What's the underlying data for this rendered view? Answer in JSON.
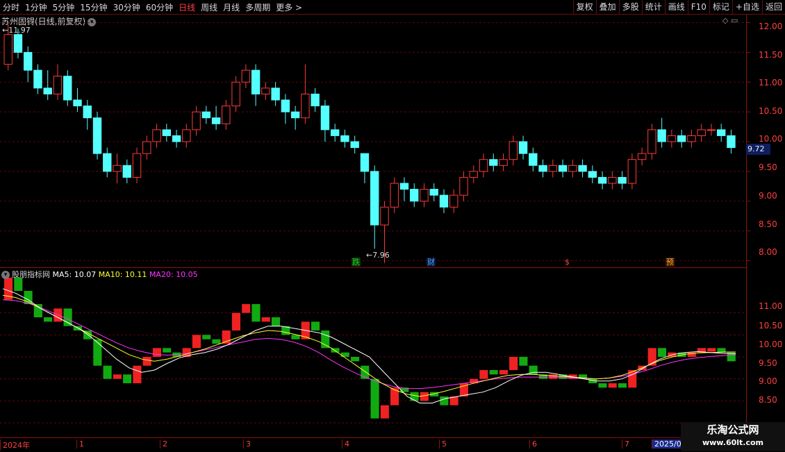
{
  "toolbar": {
    "periods": [
      "分时",
      "1分钟",
      "5分钟",
      "15分钟",
      "30分钟",
      "60分钟",
      "日线",
      "周线",
      "月线",
      "多周期",
      "更多 >"
    ],
    "active_period": "日线",
    "actions": [
      "复权",
      "叠加",
      "多股",
      "统计",
      "画线",
      "F10",
      "标记",
      "+自选",
      "返回"
    ]
  },
  "main_chart": {
    "title": "苏州固锝(日线,前复权)",
    "high_label": "11.97",
    "low_label": "7.96",
    "current_price": "9.72",
    "price_ticks": [
      "12.00",
      "11.50",
      "11.00",
      "10.50",
      "10.00",
      "9.50",
      "9.00",
      "8.50",
      "8.00"
    ],
    "tags": [
      {
        "text": "跌",
        "color": "#22cc22",
        "bg": "#0a3a0a"
      },
      {
        "text": "财",
        "color": "#4aa0ff",
        "bg": "#0a1a3a"
      },
      {
        "text": "$",
        "color": "#ff4040",
        "bg": "#000"
      },
      {
        "text": "预",
        "color": "#ffaa33",
        "bg": "#3a1a00"
      }
    ]
  },
  "indicator": {
    "name": "股朋指标网",
    "ma5": "MA5: 10.07",
    "ma10": "MA10: 10.11",
    "ma20": "MA20: 10.05",
    "ticks": [
      "11.00",
      "10.50",
      "10.00",
      "9.50",
      "9.00",
      "8.50"
    ]
  },
  "time_axis": [
    "2024年",
    "1",
    "2",
    "3",
    "4",
    "5",
    "6",
    "7",
    "2025/0"
  ],
  "watermark": {
    "line1": "乐淘公式网",
    "line2": "www.60lt.com"
  },
  "colors": {
    "up": "#ff3a3a",
    "down": "#54ffff",
    "grid": "#5a0a0a",
    "ma5": "#ffffff",
    "ma10": "#ffff33",
    "ma20": "#ff33ff"
  },
  "chart_data": {
    "type": "candlestick",
    "ylim": [
      7.9,
      12.1
    ],
    "candles": [
      [
        11.3,
        11.8,
        11.2,
        11.97
      ],
      [
        11.8,
        11.5,
        11.4,
        11.9
      ],
      [
        11.5,
        11.2,
        11.0,
        11.6
      ],
      [
        11.2,
        10.9,
        10.8,
        11.3
      ],
      [
        10.9,
        10.8,
        10.7,
        11.2
      ],
      [
        10.8,
        11.1,
        10.7,
        11.3
      ],
      [
        11.1,
        10.7,
        10.6,
        11.2
      ],
      [
        10.7,
        10.6,
        10.5,
        10.9
      ],
      [
        10.6,
        10.4,
        10.2,
        10.7
      ],
      [
        10.4,
        9.8,
        9.7,
        10.5
      ],
      [
        9.8,
        9.5,
        9.4,
        9.9
      ],
      [
        9.5,
        9.6,
        9.3,
        9.8
      ],
      [
        9.6,
        9.4,
        9.3,
        9.7
      ],
      [
        9.4,
        9.8,
        9.3,
        9.9
      ],
      [
        9.8,
        10.0,
        9.7,
        10.1
      ],
      [
        10.0,
        10.2,
        9.9,
        10.3
      ],
      [
        10.2,
        10.1,
        10.0,
        10.3
      ],
      [
        10.1,
        10.0,
        9.9,
        10.2
      ],
      [
        10.0,
        10.2,
        9.9,
        10.3
      ],
      [
        10.2,
        10.5,
        10.1,
        10.6
      ],
      [
        10.5,
        10.4,
        10.3,
        10.6
      ],
      [
        10.4,
        10.3,
        10.2,
        10.6
      ],
      [
        10.3,
        10.6,
        10.2,
        10.7
      ],
      [
        10.6,
        11.0,
        10.5,
        11.1
      ],
      [
        11.0,
        11.2,
        10.9,
        11.3
      ],
      [
        11.2,
        10.8,
        10.6,
        11.3
      ],
      [
        10.8,
        10.9,
        10.7,
        11.0
      ],
      [
        10.9,
        10.7,
        10.6,
        11.0
      ],
      [
        10.7,
        10.5,
        10.3,
        10.8
      ],
      [
        10.5,
        10.4,
        10.2,
        10.6
      ],
      [
        10.4,
        10.8,
        10.3,
        11.3
      ],
      [
        10.8,
        10.6,
        10.5,
        10.9
      ],
      [
        10.6,
        10.2,
        10.0,
        10.7
      ],
      [
        10.2,
        10.1,
        10.0,
        10.3
      ],
      [
        10.1,
        10.0,
        9.9,
        10.2
      ],
      [
        10.0,
        9.9,
        9.8,
        10.1
      ],
      [
        9.8,
        9.5,
        9.3,
        9.8
      ],
      [
        9.5,
        8.6,
        8.2,
        9.6
      ],
      [
        8.6,
        8.9,
        7.96,
        9.0
      ],
      [
        8.9,
        9.3,
        8.8,
        9.4
      ],
      [
        9.3,
        9.2,
        9.0,
        9.4
      ],
      [
        9.2,
        9.0,
        8.9,
        9.3
      ],
      [
        9.0,
        9.2,
        8.9,
        9.3
      ],
      [
        9.2,
        9.1,
        9.0,
        9.3
      ],
      [
        9.1,
        8.9,
        8.8,
        9.2
      ],
      [
        8.9,
        9.1,
        8.8,
        9.2
      ],
      [
        9.1,
        9.4,
        9.0,
        9.5
      ],
      [
        9.4,
        9.5,
        9.3,
        9.6
      ],
      [
        9.5,
        9.7,
        9.4,
        9.8
      ],
      [
        9.7,
        9.6,
        9.5,
        9.8
      ],
      [
        9.6,
        9.7,
        9.5,
        9.8
      ],
      [
        9.7,
        10.0,
        9.6,
        10.1
      ],
      [
        10.0,
        9.8,
        9.7,
        10.1
      ],
      [
        9.8,
        9.6,
        9.5,
        9.9
      ],
      [
        9.6,
        9.5,
        9.4,
        9.7
      ],
      [
        9.5,
        9.6,
        9.4,
        9.7
      ],
      [
        9.6,
        9.5,
        9.4,
        9.7
      ],
      [
        9.5,
        9.6,
        9.4,
        9.7
      ],
      [
        9.6,
        9.5,
        9.4,
        9.7
      ],
      [
        9.5,
        9.4,
        9.3,
        9.6
      ],
      [
        9.4,
        9.3,
        9.2,
        9.5
      ],
      [
        9.3,
        9.4,
        9.2,
        9.5
      ],
      [
        9.4,
        9.3,
        9.2,
        9.5
      ],
      [
        9.3,
        9.7,
        9.2,
        9.8
      ],
      [
        9.7,
        9.8,
        9.6,
        9.9
      ],
      [
        9.8,
        10.2,
        9.7,
        10.3
      ],
      [
        10.2,
        10.0,
        9.9,
        10.4
      ],
      [
        10.0,
        10.1,
        9.9,
        10.2
      ],
      [
        10.1,
        10.0,
        9.9,
        10.2
      ],
      [
        10.0,
        10.1,
        9.9,
        10.2
      ],
      [
        10.1,
        10.2,
        10.0,
        10.3
      ],
      [
        10.2,
        10.2,
        10.1,
        10.3
      ],
      [
        10.2,
        10.1,
        10.0,
        10.3
      ],
      [
        10.1,
        9.9,
        9.8,
        10.2
      ]
    ],
    "ma5": [
      11.55,
      11.45,
      11.3,
      11.1,
      10.95,
      10.8,
      10.65,
      10.45,
      10.2,
      9.95,
      9.75,
      9.65,
      9.7,
      9.85,
      9.98,
      10.05,
      10.1,
      10.18,
      10.3,
      10.45,
      10.6,
      10.7,
      10.7,
      10.65,
      10.6,
      10.55,
      10.45,
      10.3,
      10.15,
      10.0,
      9.7,
      9.4,
      9.1,
      8.95,
      8.95,
      9.05,
      9.1,
      9.15,
      9.2,
      9.3,
      9.45,
      9.58,
      9.65,
      9.65,
      9.6,
      9.55,
      9.5,
      9.45,
      9.45,
      9.5,
      9.62,
      9.8,
      9.95,
      10.05,
      10.1,
      10.12,
      10.1,
      10.08,
      10.07
    ],
    "ma10": [
      11.4,
      11.35,
      11.25,
      11.1,
      10.95,
      10.8,
      10.65,
      10.5,
      10.35,
      10.2,
      10.05,
      9.95,
      9.9,
      9.95,
      10.02,
      10.1,
      10.18,
      10.28,
      10.38,
      10.48,
      10.55,
      10.6,
      10.58,
      10.52,
      10.45,
      10.35,
      10.2,
      10.0,
      9.8,
      9.6,
      9.4,
      9.25,
      9.15,
      9.1,
      9.15,
      9.22,
      9.3,
      9.38,
      9.45,
      9.52,
      9.58,
      9.6,
      9.6,
      9.58,
      9.56,
      9.54,
      9.52,
      9.5,
      9.52,
      9.58,
      9.68,
      9.8,
      9.92,
      10.0,
      10.06,
      10.09,
      10.1,
      10.11,
      10.11
    ],
    "ma20": [
      11.3,
      11.28,
      11.22,
      11.12,
      11.0,
      10.88,
      10.74,
      10.6,
      10.46,
      10.32,
      10.2,
      10.12,
      10.06,
      10.04,
      10.06,
      10.1,
      10.16,
      10.22,
      10.28,
      10.34,
      10.4,
      10.42,
      10.4,
      10.34,
      10.24,
      10.1,
      9.92,
      9.76,
      9.62,
      9.5,
      9.4,
      9.32,
      9.28,
      9.28,
      9.3,
      9.34,
      9.38,
      9.42,
      9.46,
      9.5,
      9.52,
      9.54,
      9.54,
      9.54,
      9.53,
      9.52,
      9.51,
      9.5,
      9.52,
      9.56,
      9.62,
      9.7,
      9.8,
      9.88,
      9.94,
      9.98,
      10.01,
      10.03,
      10.05
    ]
  }
}
